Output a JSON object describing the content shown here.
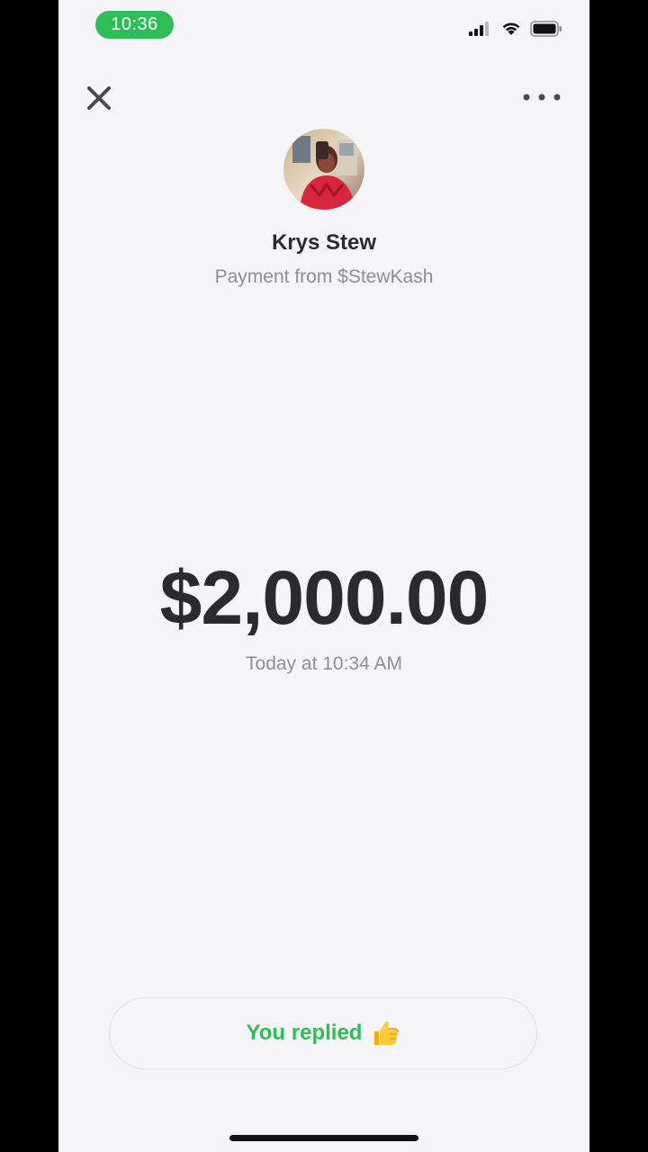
{
  "status_bar": {
    "time": "10:36",
    "time_pill_color": "#2ebd59",
    "icons": [
      "signal-icon",
      "wifi-icon",
      "battery-icon"
    ]
  },
  "nav": {
    "close_icon": "close-icon",
    "more_icon": "more-horizontal-icon"
  },
  "profile": {
    "name": "Krys Stew",
    "subtitle": "Payment from $StewKash"
  },
  "payment": {
    "amount": "$2,000.00",
    "timestamp": "Today at 10:34 AM"
  },
  "reply": {
    "label": "You replied",
    "emoji_icon": "thumbs-up-icon",
    "accent_color": "#2ebd59"
  }
}
